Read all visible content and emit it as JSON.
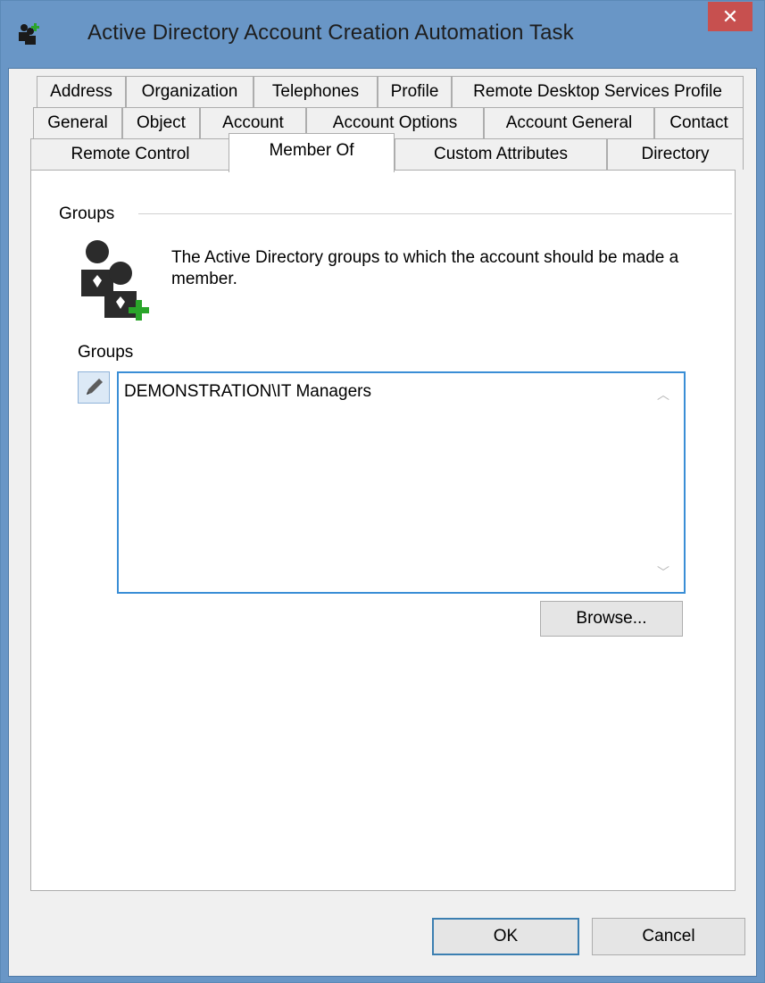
{
  "window": {
    "title": "Active Directory Account Creation Automation Task",
    "close_label": "✕"
  },
  "tabs": {
    "row1": [
      "Address",
      "Organization",
      "Telephones",
      "Profile",
      "Remote Desktop Services Profile"
    ],
    "row2": [
      "General",
      "Object",
      "Account",
      "Account Options",
      "Account General",
      "Contact"
    ],
    "row3": [
      "Remote Control",
      "Member Of",
      "Custom Attributes",
      "Directory"
    ],
    "selected": "Member Of"
  },
  "panel": {
    "section_title": "Groups",
    "description": "The Active Directory groups to which the account should be made a member.",
    "list_label": "Groups",
    "groups": [
      "DEMONSTRATION\\IT Managers"
    ],
    "browse_label": "Browse..."
  },
  "buttons": {
    "ok_label": "OK",
    "cancel_label": "Cancel"
  },
  "colors": {
    "titlebar": "#6996c6",
    "close": "#c7504f",
    "focus_border": "#3a8ed6",
    "icon_dark": "#2b2b2b",
    "icon_add": "#2aa52a"
  },
  "icons": {
    "app": "users-add-icon",
    "section": "users-add-icon",
    "edit": "pencil-icon",
    "scroll_up": "chevron-up-icon",
    "scroll_down": "chevron-down-icon"
  }
}
